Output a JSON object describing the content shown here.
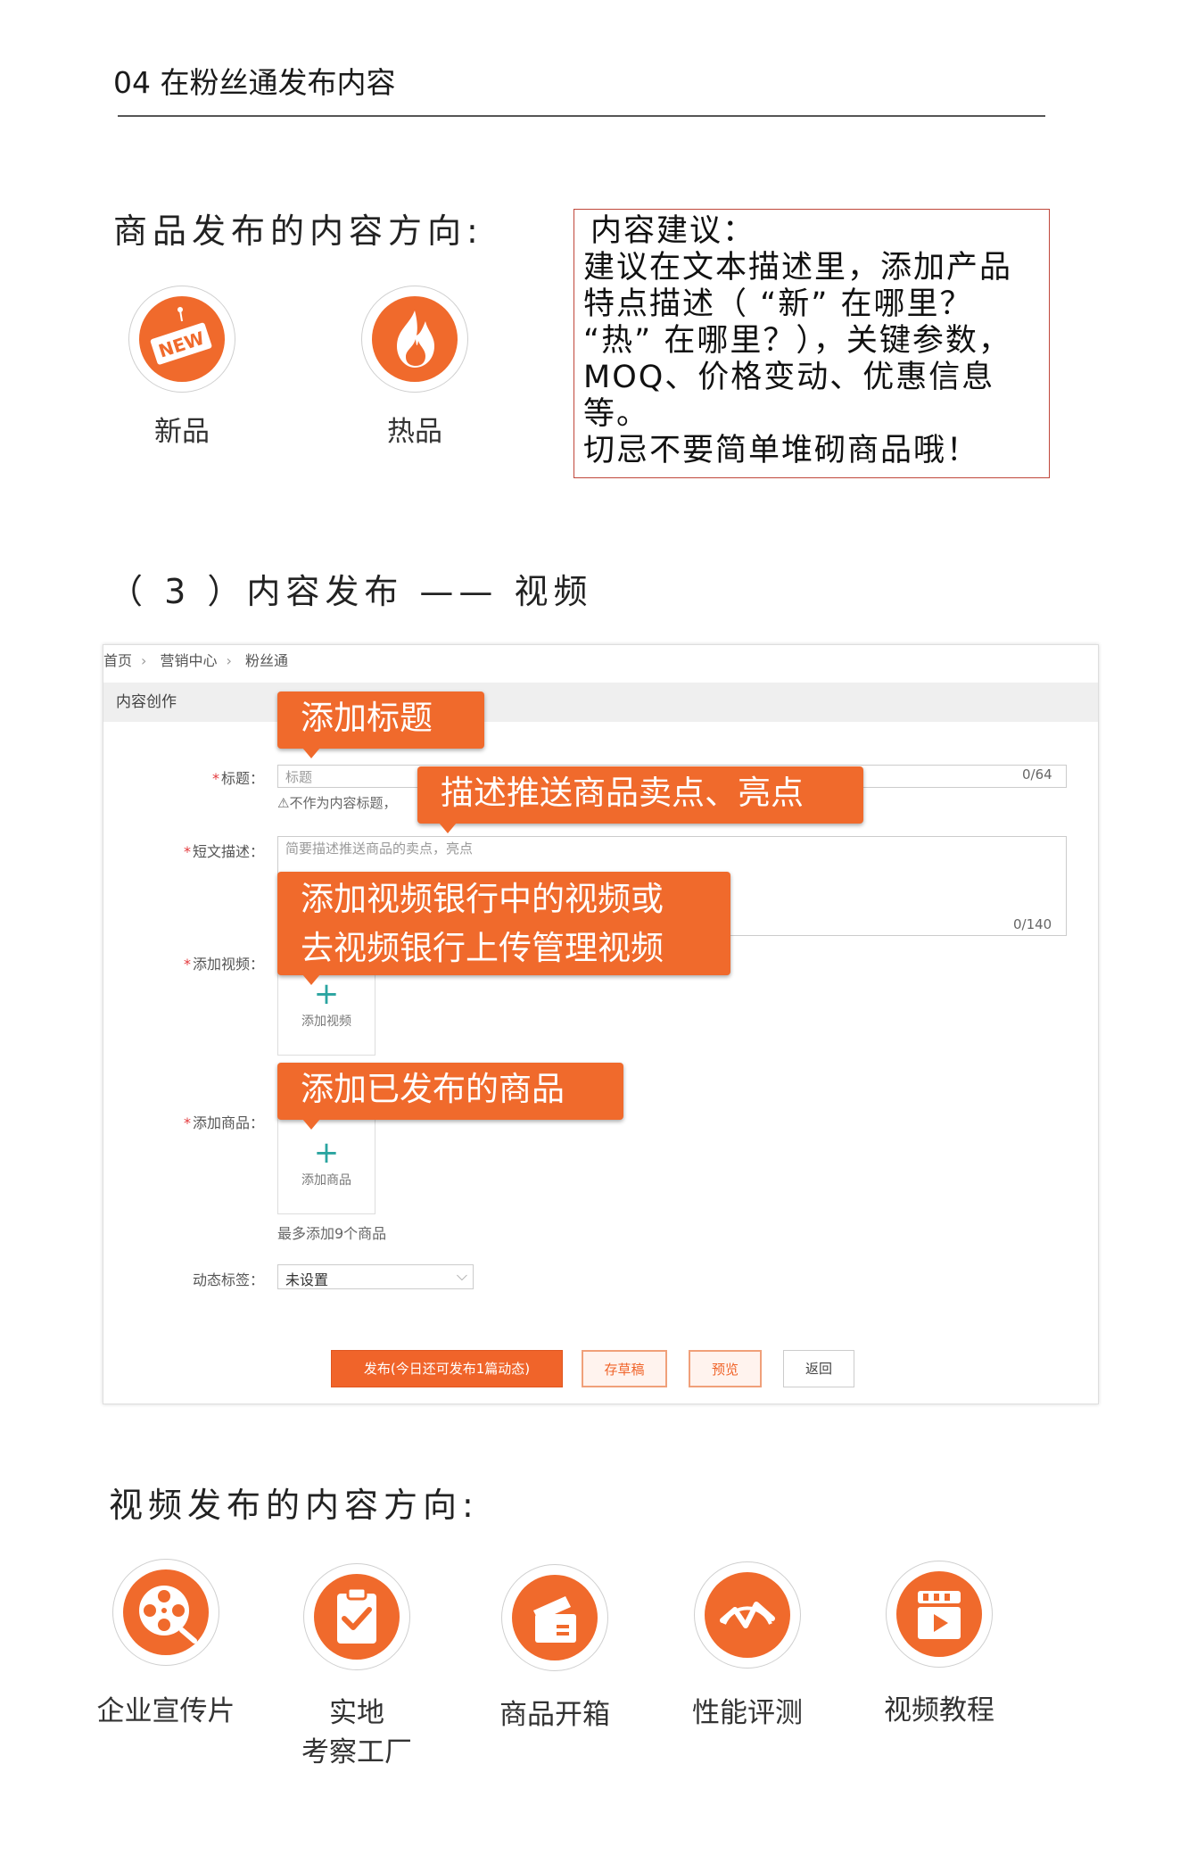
{
  "header": {
    "title": "04 在粉丝通发布内容"
  },
  "product_section": {
    "title": "商品发布的内容方向:",
    "items": [
      {
        "label": "新品",
        "icon": "new-badge-icon",
        "badge_text": "NEW"
      },
      {
        "label": "热品",
        "icon": "flame-icon"
      }
    ]
  },
  "advice": {
    "lines": [
      "内容建议：",
      "建议在文本描述里，添加产品",
      "特点描述（ “新” 在哪里？",
      "“热” 在哪里？），关键参数，",
      "MOQ、价格变动、优惠信息",
      "等。",
      "切忌不要简单堆砌商品哦！"
    ]
  },
  "video_section_title": "（ 3 ）内容发布 —— 视频",
  "screenshot": {
    "breadcrumb": [
      "首页",
      "营销中心",
      "粉丝通"
    ],
    "bar_title": "内容创作",
    "fields": {
      "title_label": "标题：",
      "title_placeholder": "标题",
      "title_counter": "0/64",
      "title_hint": "不作为内容标题，",
      "desc_label": "短文描述：",
      "desc_placeholder": "简要描述推送商品的卖点，亮点",
      "desc_counter": "0/140",
      "video_label": "添加视频：",
      "video_caption": "添加视频",
      "product_label": "添加商品：",
      "product_caption": "添加商品",
      "product_hint": "最多添加9个商品",
      "tag_label": "动态标签：",
      "tag_value": "未设置"
    },
    "buttons": {
      "publish": "发布(今日还可发布1篇动态)",
      "draft": "存草稿",
      "preview": "预览",
      "back": "返回"
    },
    "callouts": {
      "title": "添加标题",
      "desc": "描述推送商品卖点、亮点",
      "video_line1": "添加视频银行中的视频或",
      "video_line2": "去视频银行上传管理视频",
      "product": "添加已发布的商品"
    }
  },
  "video_direction": {
    "title": "视频发布的内容方向:",
    "items": [
      {
        "label": "企业宣传片",
        "icon": "film-reel-icon"
      },
      {
        "label_line1": "实地",
        "label_line2": "考察工厂",
        "icon": "clipboard-check-icon"
      },
      {
        "label": "商品开箱",
        "icon": "open-box-icon"
      },
      {
        "label": "性能评测",
        "icon": "pulse-chart-icon"
      },
      {
        "label": "视频教程",
        "icon": "video-play-icon"
      }
    ]
  },
  "colors": {
    "accent": "#f06a2c",
    "box_border": "#c0473b"
  }
}
